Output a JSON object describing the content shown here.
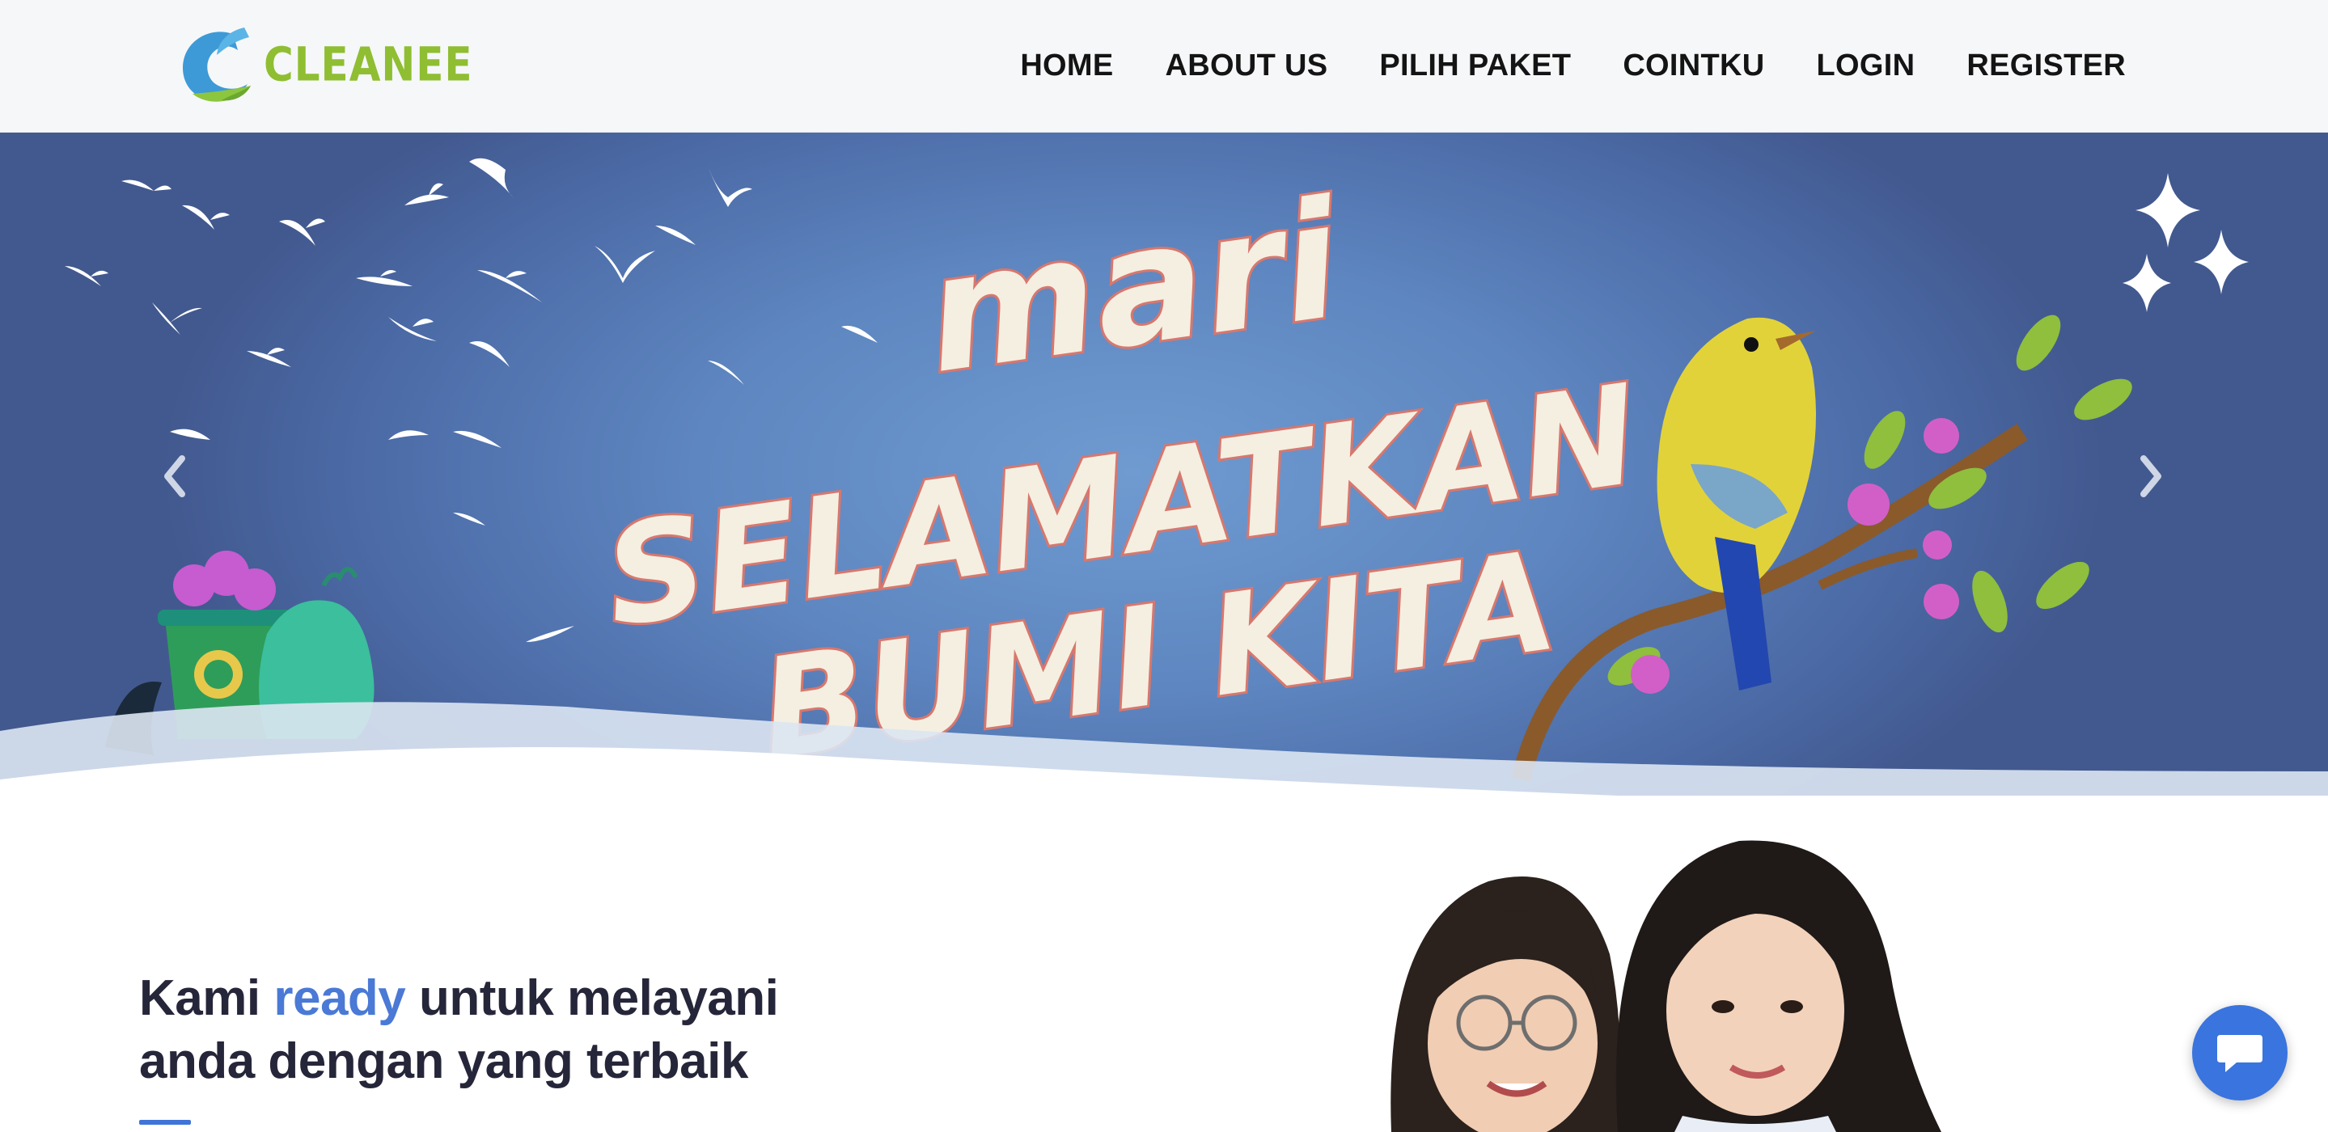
{
  "brand": {
    "name": "CLEANEE",
    "logo_icon": "leaf-c-logo-icon",
    "color": "#8fbe32"
  },
  "nav": {
    "items": [
      {
        "label": "HOME"
      },
      {
        "label": "ABOUT US"
      },
      {
        "label": "PILIH PAKET"
      },
      {
        "label": "COINTKU"
      },
      {
        "label": "LOGIN"
      },
      {
        "label": "REGISTER"
      }
    ]
  },
  "hero": {
    "slogan_lines": [
      "mari",
      "SELAMATKAN",
      "BUMI KITA"
    ],
    "prev_icon": "chevron-left-icon",
    "next_icon": "chevron-right-icon"
  },
  "about": {
    "title_part1": "Kami ",
    "title_accent": "ready",
    "title_part2": " untuk melayani",
    "title_line2": "anda dengan yang terbaik",
    "accent_color": "#4a79d6"
  },
  "chat": {
    "icon": "chat-bubble-icon",
    "color": "#3a74de"
  }
}
